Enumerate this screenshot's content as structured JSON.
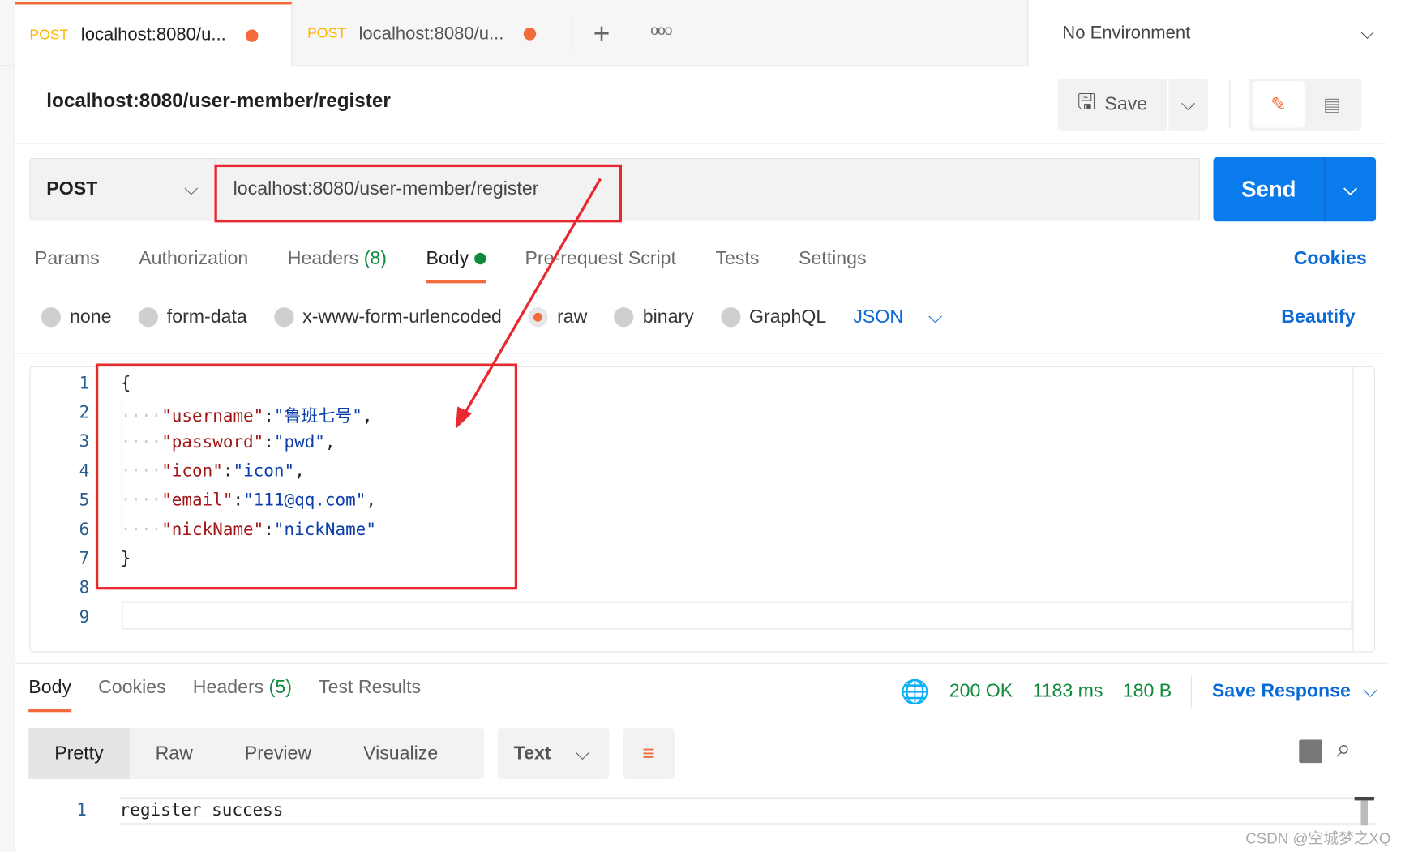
{
  "tabs": [
    {
      "method": "POST",
      "title": "localhost:8080/u..."
    },
    {
      "method": "POST",
      "title": "localhost:8080/u..."
    }
  ],
  "environment": "No Environment",
  "request": {
    "title": "localhost:8080/user-member/register",
    "method": "POST",
    "url": "localhost:8080/user-member/register",
    "save_label": "Save",
    "send_label": "Send"
  },
  "req_tabs": {
    "params": "Params",
    "authorization": "Authorization",
    "headers": "Headers",
    "headers_count": "(8)",
    "body": "Body",
    "prerequest": "Pre-request Script",
    "tests": "Tests",
    "settings": "Settings",
    "cookies": "Cookies"
  },
  "body_types": {
    "none": "none",
    "form_data": "form-data",
    "urlencoded": "x-www-form-urlencoded",
    "raw": "raw",
    "binary": "binary",
    "graphql": "GraphQL",
    "format": "JSON",
    "beautify": "Beautify",
    "selected": "raw"
  },
  "code_lines": [
    "1",
    "2",
    "3",
    "4",
    "5",
    "6",
    "7",
    "8",
    "9"
  ],
  "code": {
    "open": "{",
    "close": "}",
    "fields": [
      {
        "k": "\"username\"",
        "v": "\"鲁班七号\"",
        "end": ","
      },
      {
        "k": "\"password\"",
        "v": "\"pwd\"",
        "end": ","
      },
      {
        "k": "\"icon\"",
        "v": "\"icon\"",
        "end": ","
      },
      {
        "k": "\"email\"",
        "v": "\"111@qq.com\"",
        "end": ","
      },
      {
        "k": "\"nickName\"",
        "v": "\"nickName\"",
        "end": ""
      }
    ]
  },
  "response": {
    "tabs": {
      "body": "Body",
      "cookies": "Cookies",
      "headers": "Headers",
      "headers_count": "(5)",
      "tests": "Test Results"
    },
    "status": "200 OK",
    "time": "1183 ms",
    "size": "180 B",
    "save": "Save Response",
    "views": [
      "Pretty",
      "Raw",
      "Preview",
      "Visualize"
    ],
    "format": "Text",
    "line": "1",
    "text": "register success"
  },
  "watermark": "CSDN @空城梦之XQ",
  "colors": {
    "accent": "#f26b3a",
    "send": "#097bed",
    "success": "#0f8a3c",
    "annotation": "#e8292f"
  }
}
